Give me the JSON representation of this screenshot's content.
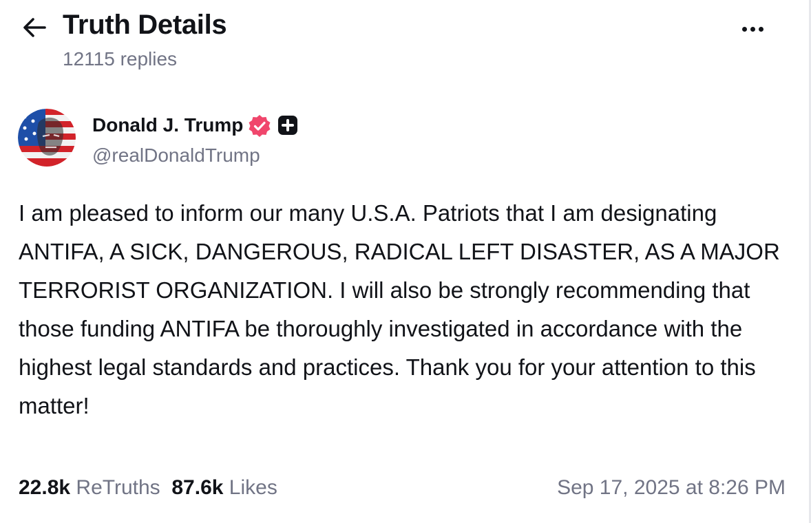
{
  "header": {
    "title": "Truth Details",
    "replies_text": "12115 replies"
  },
  "author": {
    "name": "Donald J. Trump",
    "handle": "@realDonaldTrump",
    "verified": true,
    "badge": "plus-badge"
  },
  "post": {
    "text": "I am pleased to inform our many U.S.A. Patriots that I am designating ANTIFA, A SICK, DANGEROUS, RADICAL LEFT DISASTER, AS A MAJOR TERRORIST ORGANIZATION. I will also be strongly recommending that those funding ANTIFA be thoroughly investigated in accordance with the highest legal standards and practices. Thank you for your attention to this matter!"
  },
  "stats": {
    "retruths_count": "22.8k",
    "retruths_label": "ReTruths",
    "likes_count": "87.6k",
    "likes_label": "Likes"
  },
  "timestamp": "Sep 17, 2025 at 8:26 PM",
  "icons": {
    "back": "arrow-left-icon",
    "more": "more-horizontal-icon",
    "verified": "verified-badge-icon",
    "plus": "plus-badge-icon"
  },
  "colors": {
    "text": "#111318",
    "secondary": "#717485",
    "verified": "#f0466c",
    "badge": "#111318"
  }
}
